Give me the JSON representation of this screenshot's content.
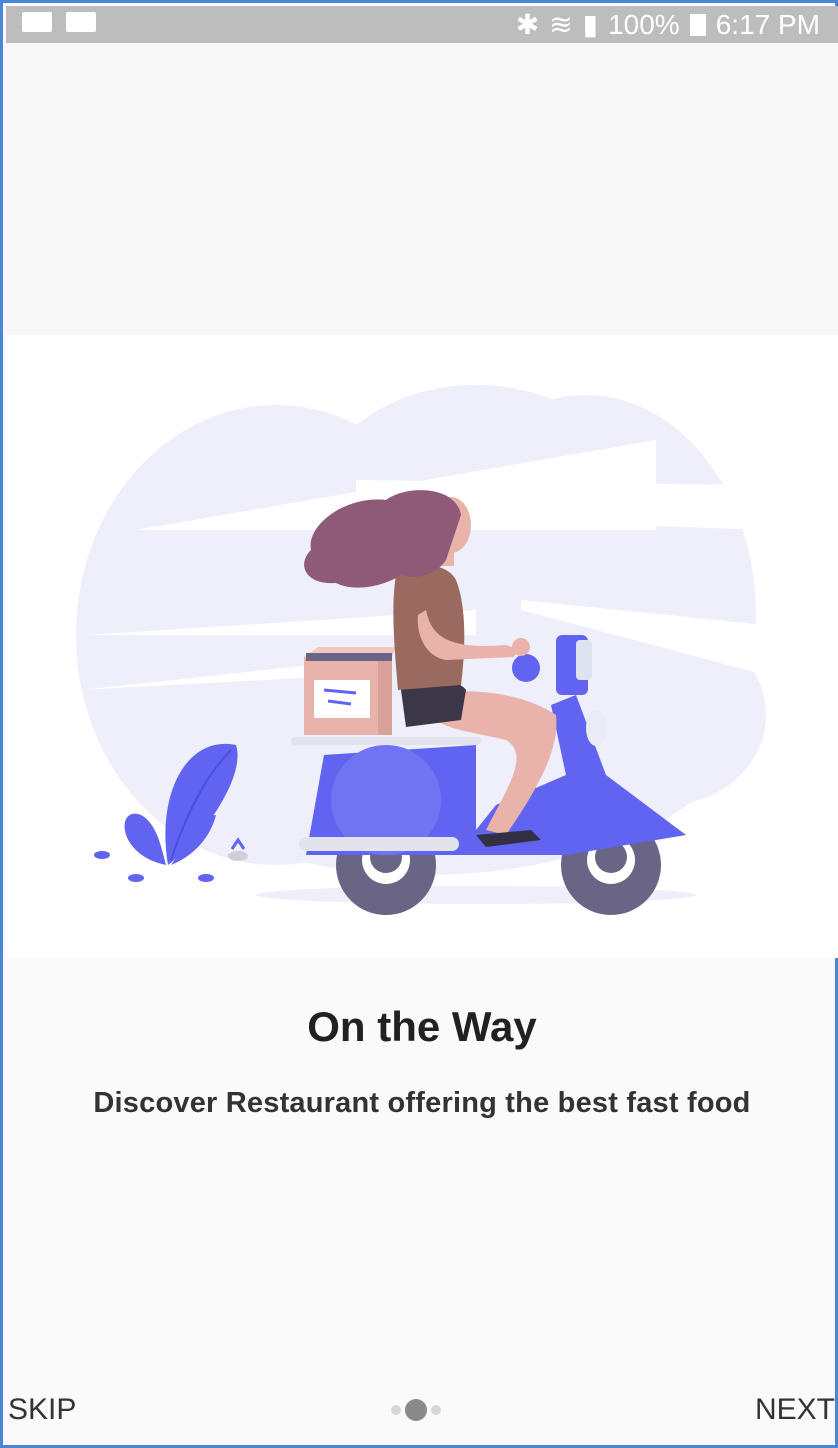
{
  "status_bar": {
    "battery": "100%",
    "time": "6:17 PM",
    "icons": [
      "keyboard-icon",
      "video-icon",
      "bluetooth-icon",
      "wifi-icon",
      "signal-icon",
      "battery-icon"
    ]
  },
  "onboarding": {
    "illustration": "woman-on-scooter-delivery",
    "title": "On the Way",
    "subtitle": "Discover Restaurant offering the best fast food"
  },
  "navigation": {
    "skip_label": "SKIP",
    "next_label": "NEXT",
    "pages": 3,
    "active_page": 2
  },
  "colors": {
    "accent": "#6064f0",
    "cloud": "#efeefb",
    "hair": "#8e5a78",
    "shirt": "#9a6a5e"
  }
}
